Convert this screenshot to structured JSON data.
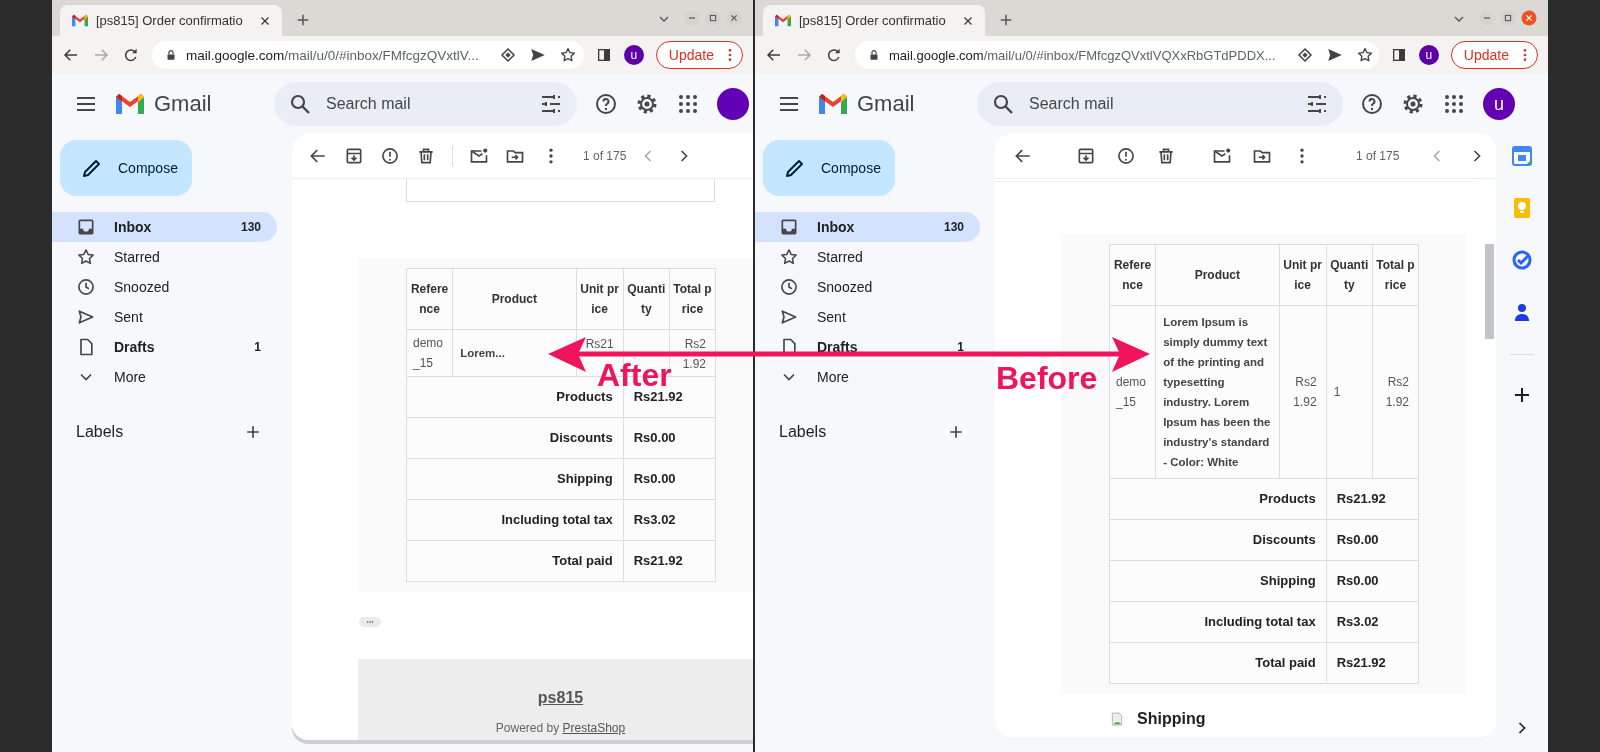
{
  "windows": [
    {
      "active": false,
      "tab": {
        "title": "[ps815] Order confirmatio"
      },
      "address_bar": {
        "host": "mail.google.com",
        "path": "/mail/u/0/#inbox/FMfcgzQVxtlV..."
      },
      "profile_initial": "u",
      "update_button": "Update",
      "gmail": {
        "app_name": "Gmail",
        "search_placeholder": "Search mail",
        "compose": "Compose",
        "nav": [
          {
            "kind": "inbox",
            "label": "Inbox",
            "count": "130",
            "selected": true,
            "unread": true
          },
          {
            "kind": "starred",
            "label": "Starred",
            "selected": false,
            "unread": false
          },
          {
            "kind": "snoozed",
            "label": "Snoozed",
            "selected": false,
            "unread": false
          },
          {
            "kind": "sent",
            "label": "Sent",
            "selected": false,
            "unread": false
          },
          {
            "kind": "drafts",
            "label": "Drafts",
            "count": "1",
            "selected": false,
            "unread": true
          },
          {
            "kind": "more",
            "label": "More",
            "selected": false,
            "unread": false
          }
        ],
        "labels_heading": "Labels",
        "pager": "1 of 175",
        "side_panel": false,
        "email": [
          {
            "kind": "cut_box"
          },
          {
            "kind": "order_table",
            "columns": [
              "Reference",
              "Product",
              "Unit price",
              "Quantity",
              "Total price"
            ],
            "rows": [
              {
                "reference": "demo_15",
                "product": "Lorem...",
                "unit_price": "Rs21",
                "total_price": "Rs21.92"
              }
            ],
            "totals": [
              {
                "label": "Products",
                "value": "Rs21.92"
              },
              {
                "label": "Discounts",
                "value": "Rs0.00"
              },
              {
                "label": "Shipping",
                "value": "Rs0.00"
              },
              {
                "label": "Including total tax",
                "value": "Rs3.02"
              },
              {
                "label": "Total paid",
                "value": "Rs21.92"
              }
            ]
          },
          {
            "kind": "trim_button"
          },
          {
            "kind": "footer",
            "shop": "ps815",
            "powered_by": "Powered by",
            "powered_link": "PrestaShop"
          }
        ]
      }
    },
    {
      "active": true,
      "tab": {
        "title": "[ps815] Order confirmatio"
      },
      "address_bar": {
        "host": "mail.google.com",
        "path": "/mail/u/0/#inbox/FMfcgzQVxtlVQXxRbGTdPDDX..."
      },
      "profile_initial": "u",
      "update_button": "Update",
      "gmail": {
        "app_name": "Gmail",
        "search_placeholder": "Search mail",
        "account_initial": "u",
        "compose": "Compose",
        "nav": [
          {
            "kind": "inbox",
            "label": "Inbox",
            "count": "130",
            "selected": true,
            "unread": true
          },
          {
            "kind": "starred",
            "label": "Starred",
            "selected": false,
            "unread": false
          },
          {
            "kind": "snoozed",
            "label": "Snoozed",
            "selected": false,
            "unread": false
          },
          {
            "kind": "sent",
            "label": "Sent",
            "selected": false,
            "unread": false
          },
          {
            "kind": "drafts",
            "label": "Drafts",
            "count": "1",
            "selected": false,
            "unread": true
          },
          {
            "kind": "more",
            "label": "More",
            "selected": false,
            "unread": false
          }
        ],
        "labels_heading": "Labels",
        "pager": "1 of 175",
        "side_panel": true,
        "email": [
          {
            "kind": "thread_rule"
          },
          {
            "kind": "order_table",
            "columns": [
              "Reference",
              "Product",
              "Unit price",
              "Quantity",
              "Total price"
            ],
            "rows": [
              {
                "reference": "demo_15",
                "product": "Lorem Ipsum is simply dummy text of the printing and typesetting industry. Lorem Ipsum has been the industry's standard - Color: White",
                "unit_price": "Rs21.92",
                "quantity": "1",
                "total_price": "Rs21.92"
              }
            ],
            "totals": [
              {
                "label": "Products",
                "value": "Rs21.92"
              },
              {
                "label": "Discounts",
                "value": "Rs0.00"
              },
              {
                "label": "Shipping",
                "value": "Rs0.00"
              },
              {
                "label": "Including total tax",
                "value": "Rs3.02"
              },
              {
                "label": "Total paid",
                "value": "Rs21.92"
              }
            ]
          },
          {
            "kind": "section_heading",
            "text": "Shipping"
          }
        ]
      }
    }
  ],
  "annotation": {
    "after_label": "After",
    "before_label": "Before"
  }
}
